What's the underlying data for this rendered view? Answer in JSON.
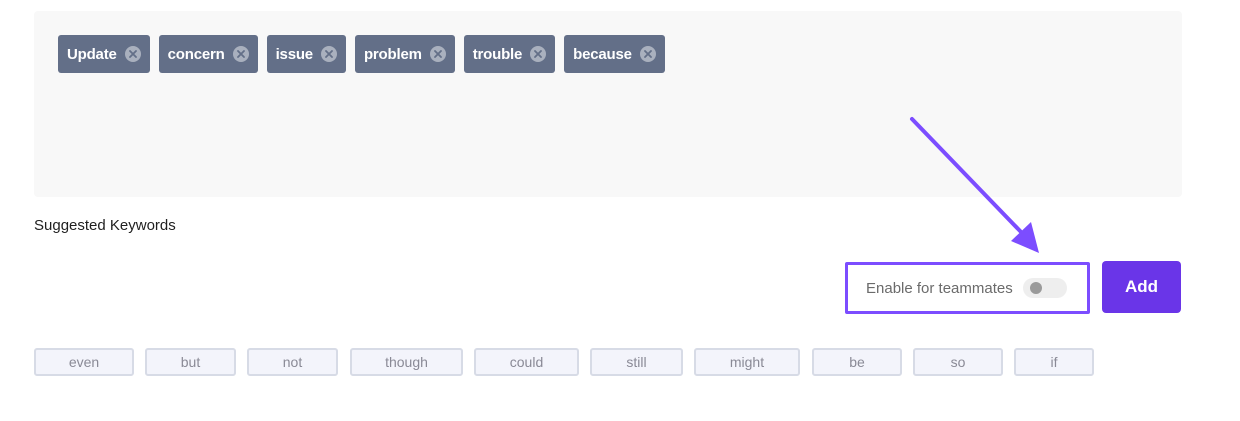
{
  "keywords": {
    "tags": [
      {
        "label": "Update"
      },
      {
        "label": "concern"
      },
      {
        "label": "issue"
      },
      {
        "label": "problem"
      },
      {
        "label": "trouble"
      },
      {
        "label": "because"
      }
    ]
  },
  "suggested": {
    "title": "Suggested Keywords",
    "chips": [
      {
        "label": "even"
      },
      {
        "label": "but"
      },
      {
        "label": "not"
      },
      {
        "label": "though"
      },
      {
        "label": "could"
      },
      {
        "label": "still"
      },
      {
        "label": "might"
      },
      {
        "label": "be"
      },
      {
        "label": "so"
      },
      {
        "label": "if"
      }
    ]
  },
  "teammates": {
    "label": "Enable for teammates",
    "enabled": false
  },
  "actions": {
    "add_label": "Add"
  },
  "colors": {
    "accent": "#6a35e8",
    "highlight": "#7c4dff",
    "tag_bg": "#636f88"
  }
}
